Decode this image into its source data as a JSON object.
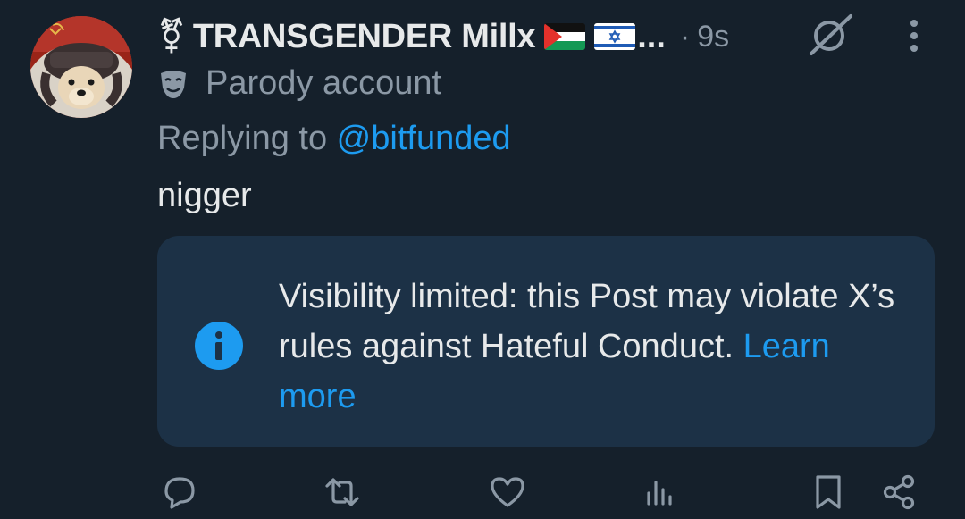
{
  "post": {
    "name_symbol": "⚧",
    "display_name": "TRANSGENDER Millx",
    "flags": [
      "palestine-flag",
      "israel-flag"
    ],
    "ellipsis": "...",
    "separator": "·",
    "timestamp": "9s",
    "parody_label": "Parody account",
    "reply_prefix": "Replying to ",
    "reply_handle": "@bitfunded",
    "text": "nigger"
  },
  "notice": {
    "message": "Visibility limited: this Post may violate X’s rules against Hateful Conduct. ",
    "link": "Learn more"
  },
  "actions": [
    "reply-icon",
    "repost-icon",
    "like-icon",
    "views-icon",
    "bookmark-icon",
    "share-icon"
  ],
  "colors": {
    "background": "#15202b",
    "text": "#e7e9ea",
    "secondary": "#8b98a5",
    "accent": "#1d9bf0",
    "notice_background": "#1c3146"
  }
}
